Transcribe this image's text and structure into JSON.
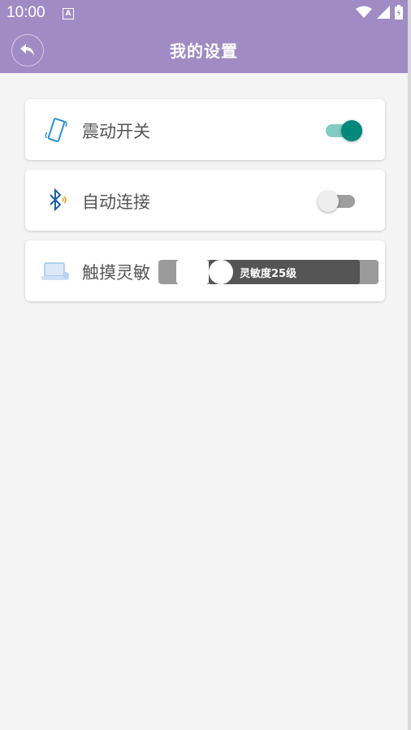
{
  "status_bar": {
    "time": "10:00",
    "notification_letter": "A"
  },
  "app_bar": {
    "title": "我的设置"
  },
  "settings": [
    {
      "label": "震动开关",
      "icon": "phone-vibrate-icon",
      "control": "switch",
      "on": true
    },
    {
      "label": "自动连接",
      "icon": "bluetooth-icon",
      "control": "switch",
      "on": false
    },
    {
      "label": "触摸灵敏",
      "icon": "touchpad-icon",
      "control": "seekbar",
      "value_text": "灵敏度25级",
      "level": 25
    }
  ],
  "colors": {
    "header": "#a08bc4",
    "switch_on_thumb": "#00897b",
    "switch_on_track": "#80cbc4",
    "switch_off_thumb": "#eeeeee",
    "switch_off_track": "#9e9e9e",
    "background": "#f4f4f4"
  }
}
